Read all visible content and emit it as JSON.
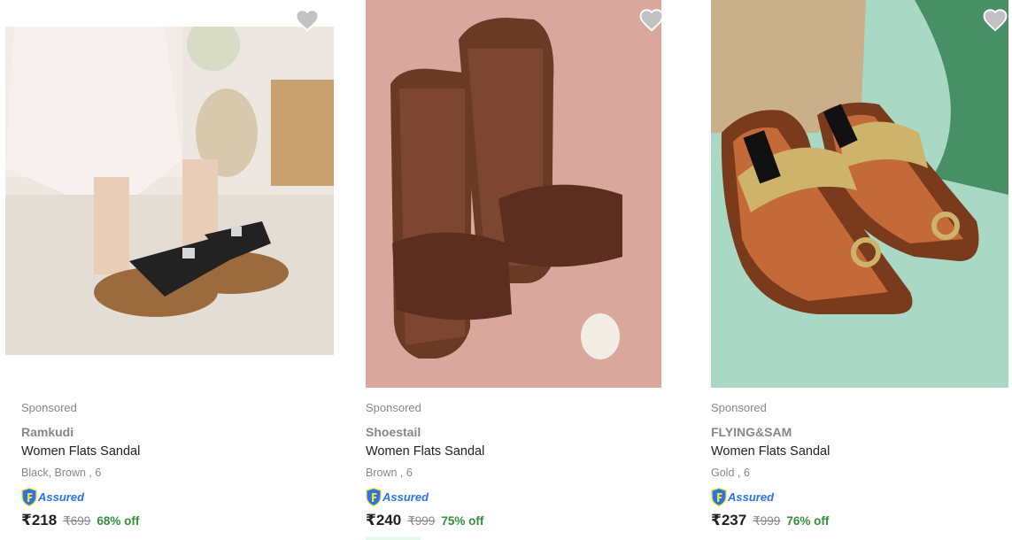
{
  "products": [
    {
      "sponsored_label": "Sponsored",
      "brand": "Ramkudi",
      "title": "Women Flats Sandal",
      "variant": "Black, Brown , 6",
      "assured_label": "Assured",
      "price": "₹218",
      "mrp": "₹699",
      "discount": "68% off",
      "image_icon": "sandal-black-bow-photo"
    },
    {
      "sponsored_label": "Sponsored",
      "brand": "Shoestail",
      "title": "Women Flats Sandal",
      "variant": "Brown , 6",
      "assured_label": "Assured",
      "price": "₹240",
      "mrp": "₹999",
      "discount": "75% off",
      "image_icon": "sandal-brown-leather-photo"
    },
    {
      "sponsored_label": "Sponsored",
      "brand": "FLYING&SAM",
      "title": "Women Flats Sandal",
      "variant": "Gold , 6",
      "assured_label": "Assured",
      "price": "₹237",
      "mrp": "₹999",
      "discount": "76% off",
      "image_icon": "sandal-gold-kolhapuri-photo"
    }
  ],
  "colors": {
    "accent_blue": "#2874f0",
    "discount_green": "#388e3c",
    "muted_grey": "#878787",
    "wishlist_heart": "#c2c2c2"
  }
}
